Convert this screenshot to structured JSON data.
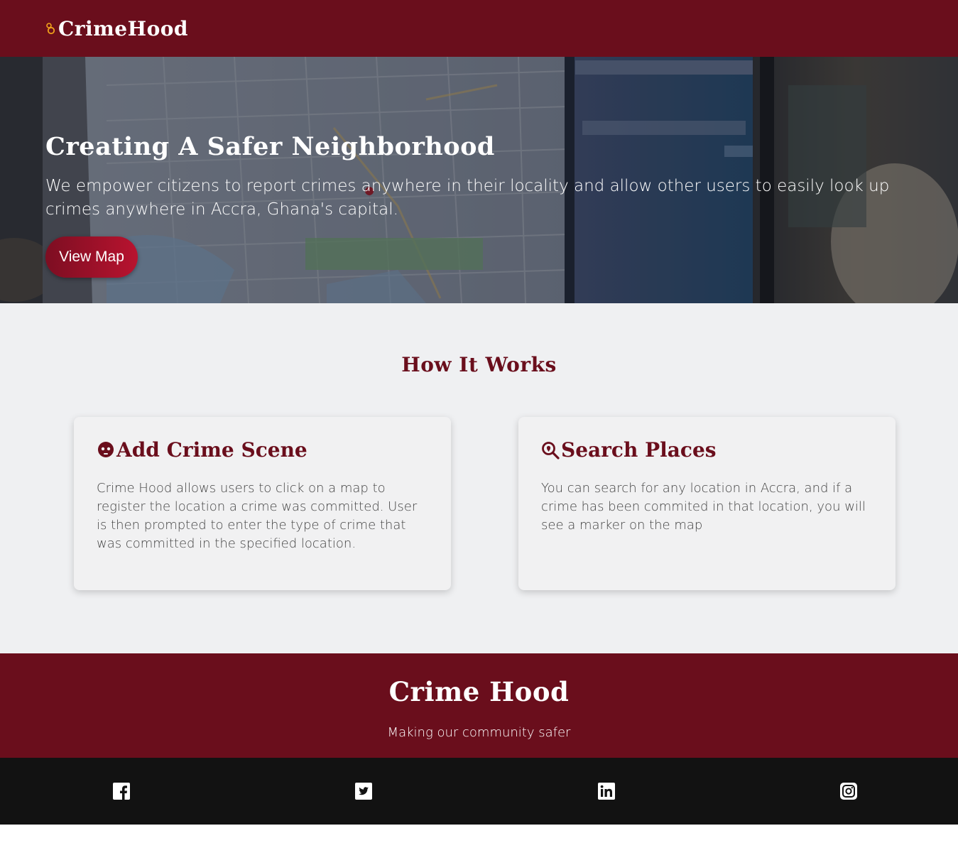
{
  "navbar": {
    "brand": "CrimeHood",
    "brand_icon": "handcuffs-icon"
  },
  "hero": {
    "title": "Creating A Safer Neighborhood",
    "description": "We empower citizens to report crimes anywhere in their locality and allow other users to easily look up crimes anywhere in Accra, Ghana's capital.",
    "button_label": "View Map",
    "background": "city-map-on-laptop-photo"
  },
  "how_it_works": {
    "title": "How It Works",
    "cards": [
      {
        "icon": "masked-robber-icon",
        "title": "Add Crime Scene",
        "body": "Crime Hood allows users to click on a map to register the location a crime was committed. User is then prompted to enter the type of crime that was committed in the specified location."
      },
      {
        "icon": "search-location-icon",
        "title": "Search Places",
        "body": "You can search for any location in Accra, and if a crime has been commited in that location, you will see a marker on the map"
      }
    ]
  },
  "footer": {
    "title": "Crime Hood",
    "tagline": "Making our community safer"
  },
  "social": {
    "icons": [
      "facebook-icon",
      "twitter-icon",
      "linkedin-icon",
      "instagram-icon"
    ]
  },
  "colors": {
    "brand": "#6a0e1c",
    "accent_gold": "#f0a11b",
    "button_gradient_start": "#7d0e22",
    "button_gradient_end": "#b8132f",
    "section_bg": "#eff0f2",
    "social_bar": "#121212"
  }
}
